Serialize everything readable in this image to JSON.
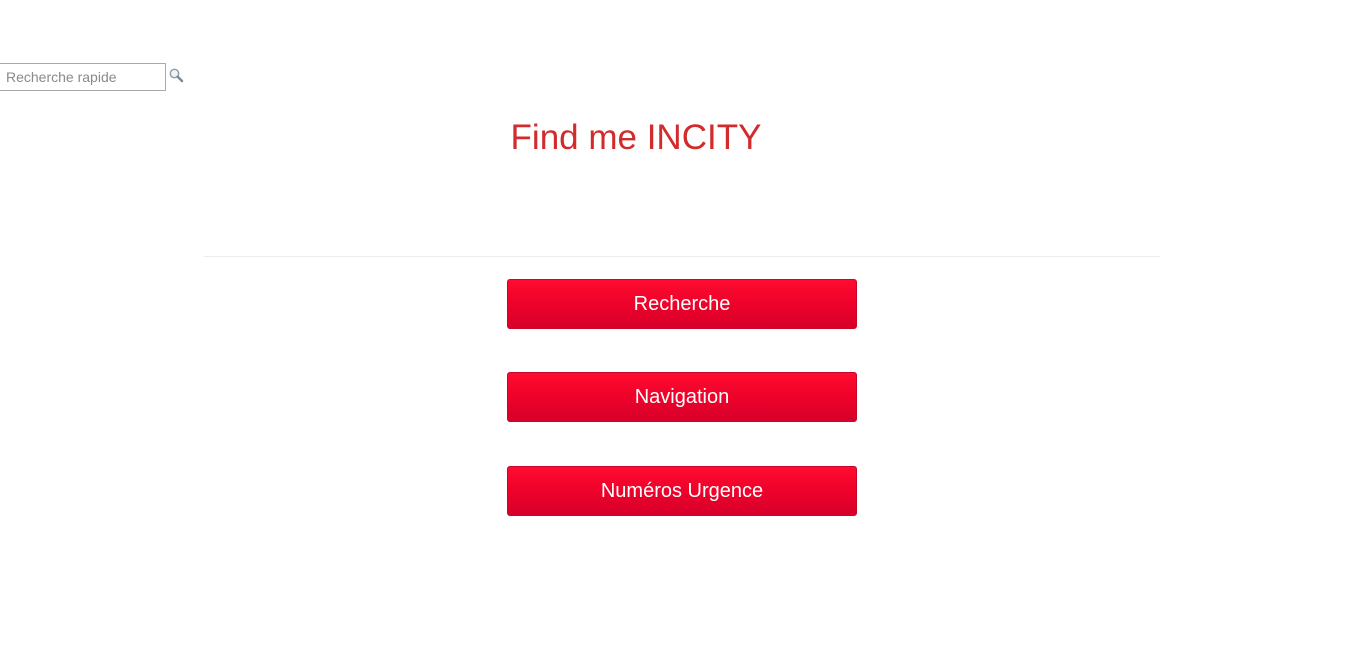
{
  "quick_search": {
    "placeholder": "Recherche rapide",
    "value": "",
    "icon": "magnifier-icon"
  },
  "header": {
    "title": "Find me INCITY"
  },
  "menu": {
    "buttons": [
      {
        "label": "Recherche"
      },
      {
        "label": "Navigation"
      },
      {
        "label": "Numéros Urgence"
      }
    ]
  },
  "colors": {
    "title": "#d12b2b",
    "button_top": "#ff0c30",
    "button_bottom": "#d6002a",
    "button_text": "#ffffff",
    "divider": "#ececec"
  }
}
